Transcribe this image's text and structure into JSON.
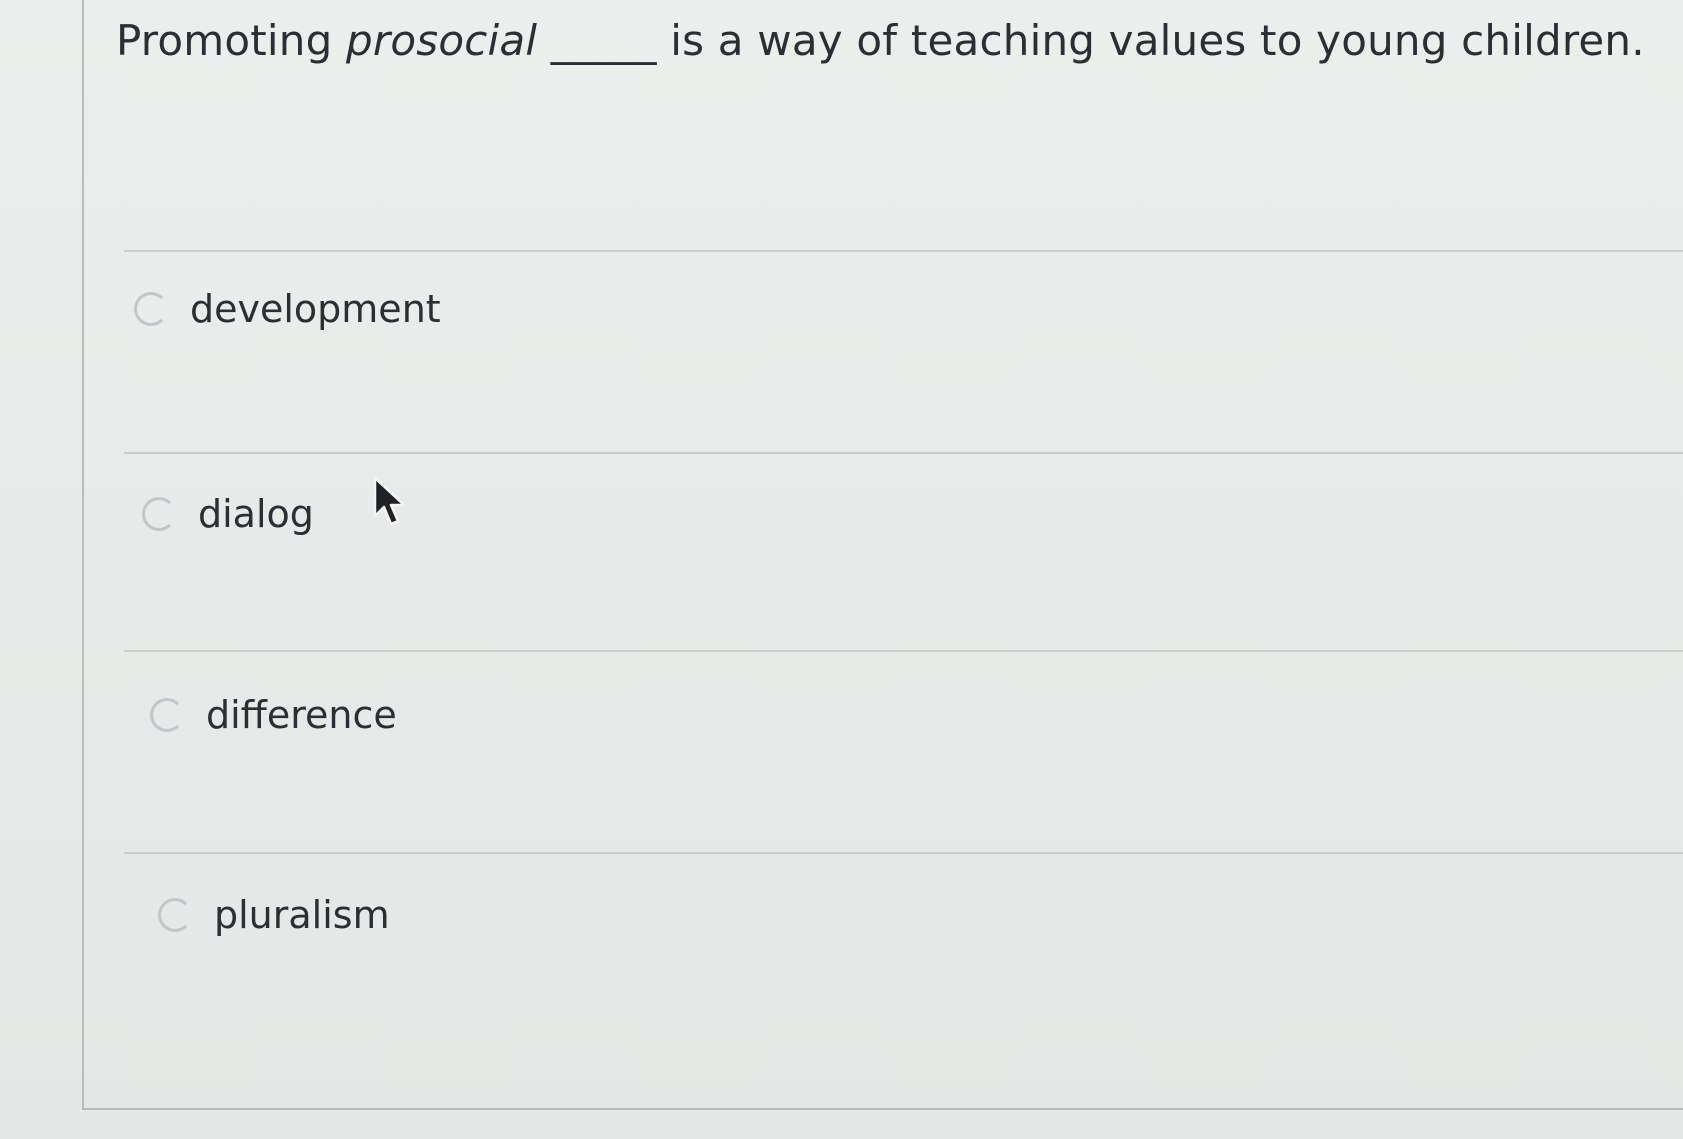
{
  "question": {
    "prefix": "Promoting ",
    "emphasis": "prosocial",
    "blank": " _____ ",
    "suffix": "is a way of teaching values to young children."
  },
  "options": [
    {
      "label": "development",
      "selected": false
    },
    {
      "label": "dialog",
      "selected": false
    },
    {
      "label": "difference",
      "selected": false
    },
    {
      "label": "pluralism",
      "selected": false
    }
  ],
  "icons": {
    "radio": "radio-button-icon",
    "cursor": "mouse-pointer-icon"
  }
}
